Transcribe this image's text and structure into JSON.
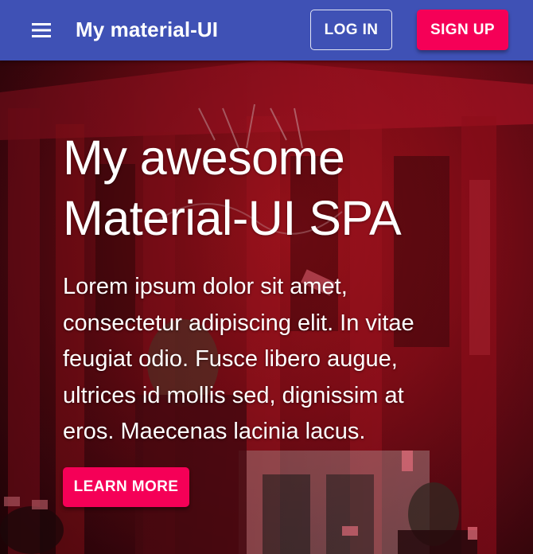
{
  "appbar": {
    "menu_icon": "hamburger-menu-icon",
    "title": "My material-UI",
    "login_label": "LOG IN",
    "signup_label": "SIGN UP",
    "background_color": "#3f51b5"
  },
  "hero": {
    "title_line1": "My awesome",
    "title_line2": "Material-UI SPA",
    "body_line1": "Lorem ipsum dolor sit amet,",
    "body_line2": "consectetur adipiscing elit. In vitae",
    "body_line3": "feugiat odio. Fusce libero augue,",
    "body_line4": "ultrices id mollis sed, dignissim at",
    "body_line5": "eros. Maecenas lacinia lacus.",
    "cta_label": "LEARN MORE",
    "accent_color": "#f50057",
    "background_image": "red-lit-building-protest-crowd-photo"
  }
}
